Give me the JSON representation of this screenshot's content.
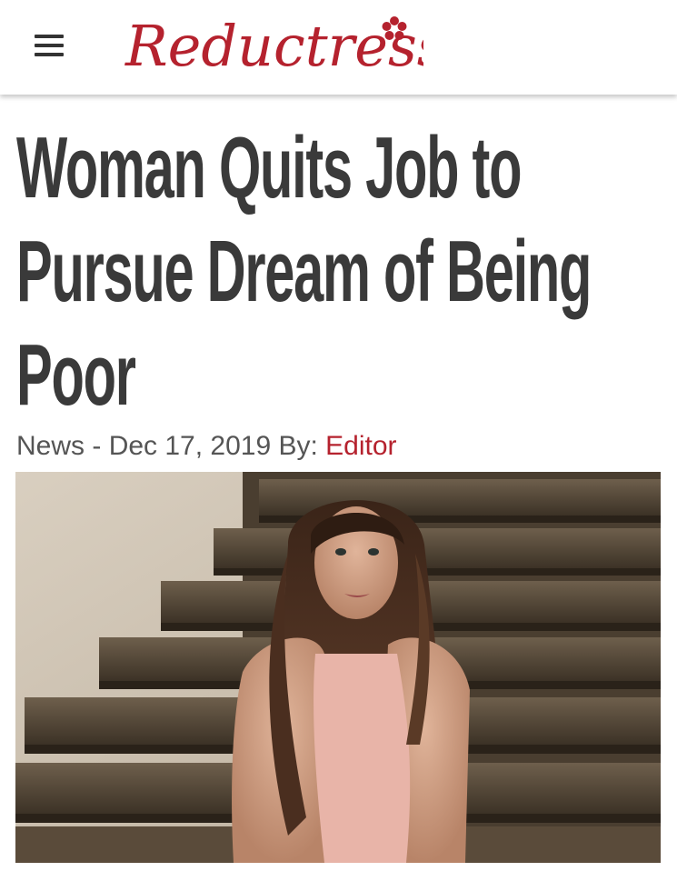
{
  "header": {
    "menu_icon": "hamburger-menu-icon",
    "logo_text": "Reductress",
    "logo_color": "#b5222e"
  },
  "article": {
    "headline_lines": [
      "Woman Quits Job to",
      "Pursue Dream of Being",
      "Poor"
    ],
    "category": "News",
    "separator": " - ",
    "date": "Dec 17, 2019",
    "by_label": " By: ",
    "author": "Editor",
    "accent_color": "#b5222e"
  }
}
